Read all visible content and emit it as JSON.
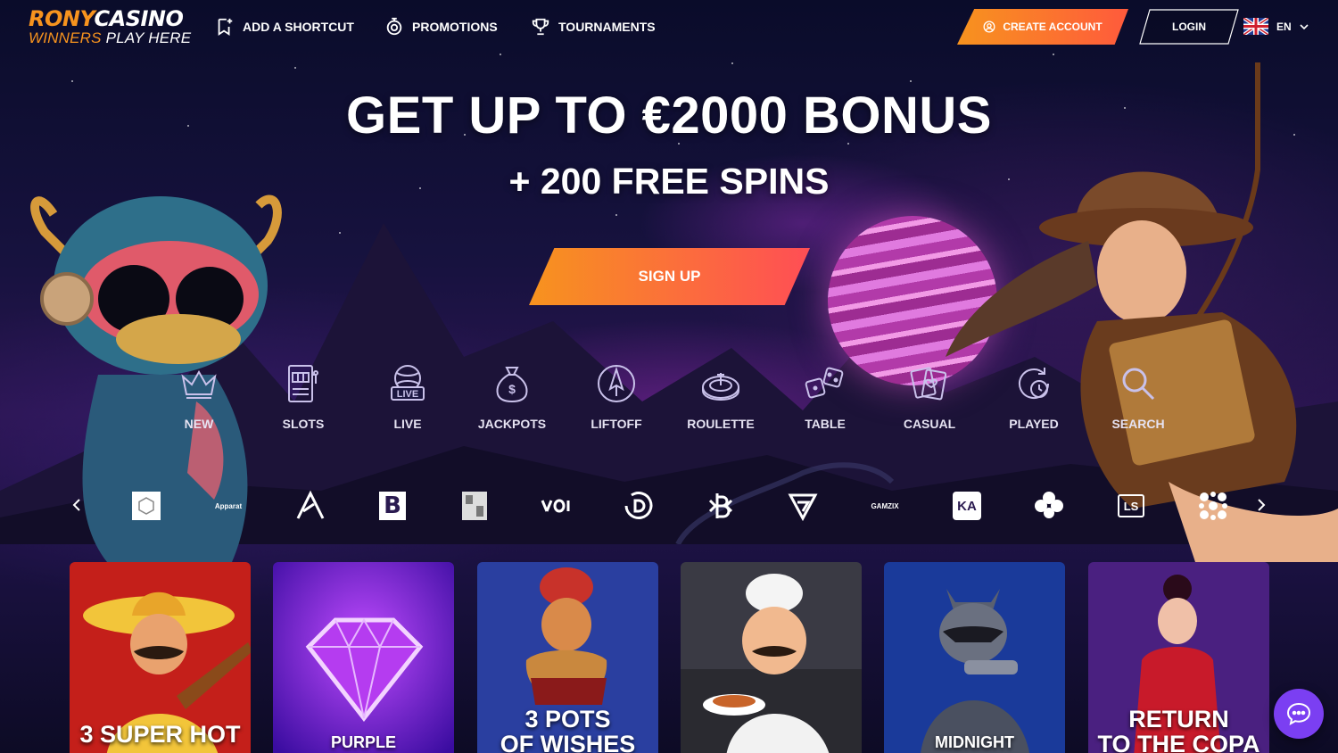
{
  "logo": {
    "brand_part1": "RONY",
    "brand_part2": "CASINO",
    "tagline_part1": "WINNERS",
    "tagline_part2": "PLAY HERE"
  },
  "nav": [
    {
      "label": "ADD A SHORTCUT",
      "icon": "bookmark-add-icon"
    },
    {
      "label": "PROMOTIONS",
      "icon": "chip-icon"
    },
    {
      "label": "TOURNAMENTS",
      "icon": "trophy-icon"
    }
  ],
  "header": {
    "create_account": "CREATE ACCOUNT",
    "login": "LOGIN",
    "language": "EN"
  },
  "hero": {
    "title": "GET UP TO €2000 BONUS",
    "subtitle": "+ 200 FREE SPINS",
    "cta": "SIGN UP"
  },
  "categories": [
    {
      "label": "NEW",
      "icon": "crown-icon"
    },
    {
      "label": "SLOTS",
      "icon": "slot-machine-icon"
    },
    {
      "label": "LIVE",
      "icon": "live-icon"
    },
    {
      "label": "JACKPOTS",
      "icon": "money-bag-icon"
    },
    {
      "label": "LIFTOFF",
      "icon": "rocket-icon"
    },
    {
      "label": "ROULETTE",
      "icon": "roulette-icon"
    },
    {
      "label": "TABLE",
      "icon": "dice-icon"
    },
    {
      "label": "CASUAL",
      "icon": "cards-icon"
    },
    {
      "label": "PLAYED",
      "icon": "history-icon"
    },
    {
      "label": "SEARCH",
      "icon": "search-icon"
    }
  ],
  "providers": {
    "apparat_text": "Apparat",
    "gamzix_text": "GAMZIX",
    "b_text": "B",
    "ka_text": "KA",
    "ls_text": "LS"
  },
  "games": [
    {
      "name_line1": "3 SUPER HOT",
      "name_line2": ""
    },
    {
      "name_line1": "PURPLE",
      "name_line2": ""
    },
    {
      "name_line1": "3 POTS",
      "name_line2": "OF WISHES"
    },
    {
      "name_line1": "",
      "name_line2": ""
    },
    {
      "name_line1": "MIDNIGHT",
      "name_line2": ""
    },
    {
      "name_line1": "RETURN",
      "name_line2": "TO THE COPA"
    }
  ],
  "colors": {
    "accent_orange": "#f7931e",
    "accent_red": "#ff4e55",
    "chat_purple": "#7b3ff2"
  }
}
